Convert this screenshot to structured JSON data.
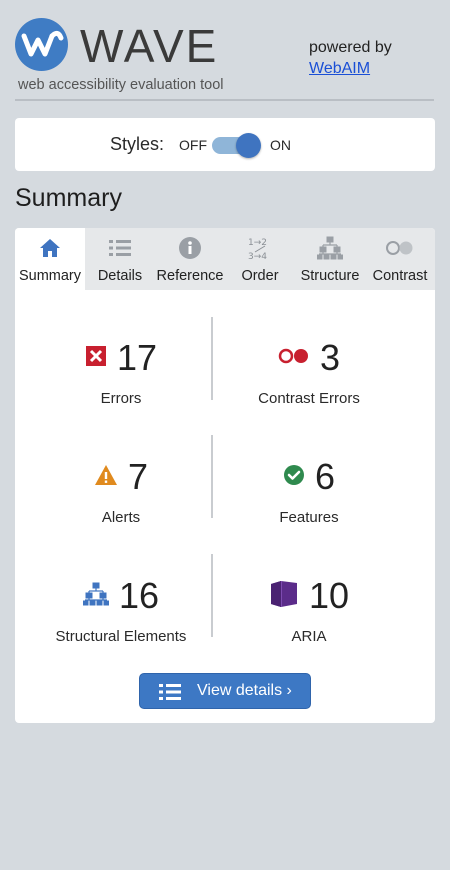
{
  "header": {
    "logo_text": "WAVE",
    "tagline": "web accessibility evaluation tool",
    "powered_by": "powered by",
    "powered_link": "WebAIM"
  },
  "styles": {
    "label": "Styles:",
    "off": "OFF",
    "on": "ON",
    "state": "on"
  },
  "section_title": "Summary",
  "tabs": [
    {
      "label": "Summary",
      "icon": "home-icon",
      "active": true
    },
    {
      "label": "Details",
      "icon": "list-icon",
      "active": false
    },
    {
      "label": "Reference",
      "icon": "info-icon",
      "active": false
    },
    {
      "label": "Order",
      "icon": "order-icon",
      "active": false
    },
    {
      "label": "Structure",
      "icon": "structure-icon",
      "active": false
    },
    {
      "label": "Contrast",
      "icon": "contrast-icon",
      "active": false
    }
  ],
  "summary": [
    {
      "count": "17",
      "label": "Errors",
      "icon": "error-icon"
    },
    {
      "count": "3",
      "label": "Contrast Errors",
      "icon": "contrast-error-icon"
    },
    {
      "count": "7",
      "label": "Alerts",
      "icon": "alert-icon"
    },
    {
      "count": "6",
      "label": "Features",
      "icon": "feature-icon"
    },
    {
      "count": "16",
      "label": "Structural Elements",
      "icon": "structure-icon"
    },
    {
      "count": "10",
      "label": "ARIA",
      "icon": "aria-icon"
    }
  ],
  "view_details": "View details ›",
  "colors": {
    "brand_blue": "#3f7cc4",
    "error_red": "#c8202f",
    "alert_orange": "#e08a1e",
    "feature_green": "#2f8a4e",
    "aria_purple": "#5b2c8a"
  }
}
